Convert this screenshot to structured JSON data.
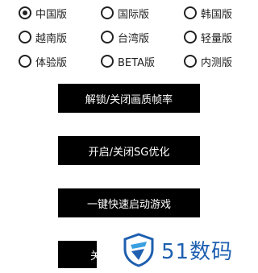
{
  "options": [
    {
      "label": "中国版",
      "checked": true
    },
    {
      "label": "国际版",
      "checked": false
    },
    {
      "label": "韩国版",
      "checked": false
    },
    {
      "label": "越南版",
      "checked": false
    },
    {
      "label": "台湾版",
      "checked": false
    },
    {
      "label": "轻量版",
      "checked": false
    },
    {
      "label": "体验版",
      "checked": false
    },
    {
      "label": "BETA版",
      "checked": false
    },
    {
      "label": "内测版",
      "checked": false
    }
  ],
  "buttons": {
    "unlock_label": "解锁/关闭画质帧率",
    "sg_label": "开启/关闭SG优化",
    "quick_start_label": "一键快速启动游戏",
    "partial_label": "关"
  },
  "watermark": {
    "text": "51数码",
    "color": "#1e5fb0"
  }
}
